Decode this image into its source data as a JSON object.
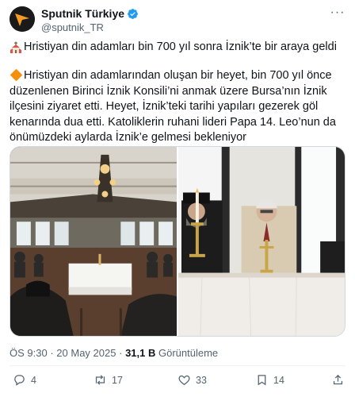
{
  "account": {
    "display_name": "Sputnik Türkiye",
    "handle": "@sputnik_TR",
    "verified_icon": "verified-badge-icon",
    "avatar_icon": "sputnik-logo-icon"
  },
  "post": {
    "title": "Hristiyan din adamları bin 700 yıl sonra İznik’te bir araya geldi",
    "body": "Hristiyan din adamlarından oluşan bir heyet, bin 700 yıl önce düzenlenen Birinci İznik Konsili’ni anmak üzere Bursa’nın İznik ilçesini ziyaret etti. Heyet, İznik’teki tarihi yapıları gezerek göl kenarında dua etti. Katoliklerin ruhani lideri Papa 14. Leo’nun da önümüzdeki aylarda İznik’e gelmesi bekleniyor",
    "title_icon": "church-icon",
    "body_icon": "orange-diamond-icon"
  },
  "meta": {
    "time": "ÖS 9:30",
    "separator": "·",
    "date": "20 May 2025",
    "views": "31,1 B",
    "views_label": "Görüntüleme"
  },
  "actions": {
    "replies": "4",
    "reposts": "17",
    "likes": "33",
    "bookmarks": "14"
  },
  "colors": {
    "text": "#0f1419",
    "muted": "#536471",
    "verified": "#1d9bf0",
    "accent_orange": "#f4900c"
  }
}
